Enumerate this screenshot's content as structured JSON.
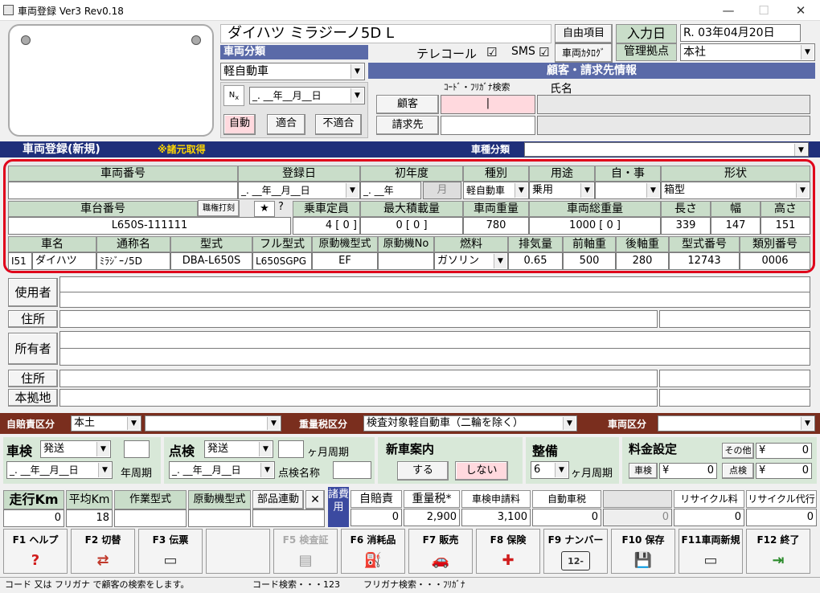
{
  "window": {
    "title": "車両登録 Ver3 Rev0.18",
    "min": "—",
    "max": "☐",
    "close": "✕"
  },
  "vehicle_title": "ダイハツ ミラジーノ5D L",
  "vehicle_class": {
    "label": "車両分類",
    "value": "軽自動車"
  },
  "telecall": {
    "label": "テレコール",
    "checked": "☑"
  },
  "sms": {
    "label": "SMS",
    "checked": "☑"
  },
  "buttons": {
    "free_item": "自由項目",
    "vehicle_catalog": "車両ｶﾀﾛｸﾞ",
    "auto": "自動",
    "fit": "適合",
    "unfit": "不適合",
    "customer": "顧客",
    "biller": "請求先",
    "inspect_yes": "する",
    "inspect_no": "しない",
    "shaken": "車検",
    "tenken": "点検",
    "other": "その他"
  },
  "input_date": {
    "label": "入力日",
    "value": "R. 03年04月20日"
  },
  "management": {
    "label": "管理拠点",
    "value": "本社"
  },
  "no_date": "_. __年__月__日",
  "customer_section": {
    "title": "顧客・請求先情報",
    "code_label": "ｺｰﾄﾞ・ﾌﾘｶﾞﾅ検索",
    "name_label": "氏名",
    "cursor": "|"
  },
  "reg_bar": {
    "title": "車両登録(新規)",
    "note": "※諸元取得",
    "type_label": "車種分類"
  },
  "row1": {
    "headers": [
      "車両番号",
      "登録日",
      "初年度",
      "種別",
      "用途",
      "自・事",
      "形状"
    ],
    "reg_date": "_. __年__月__日",
    "first_year": "_. __年",
    "first_month": "月",
    "kind": "軽自動車",
    "use": "乗用",
    "shape": "箱型"
  },
  "row2": {
    "headers": [
      "車台番号",
      "乗車定員",
      "最大積載量",
      "車両重量",
      "車両総重量",
      "長さ",
      "幅",
      "高さ"
    ],
    "stamp_btn": "職権打刻",
    "star": "★",
    "q": "?",
    "chassis": "L650S-111111",
    "capacity": "4 [ 0 ]",
    "max_load": "0 [ 0 ]",
    "weight": "780",
    "gross": "1000 [ 0 ]",
    "length": "339",
    "width": "147",
    "height": "151"
  },
  "row3": {
    "headers": [
      "車名",
      "通称名",
      "型式",
      "フル型式",
      "原動機型式",
      "原動機No",
      "燃料",
      "排気量",
      "前軸重",
      "後軸重",
      "型式番号",
      "類別番号"
    ],
    "maker_code": "I51",
    "maker": "ダイハツ",
    "common": "ﾐﾗｼﾞｰﾉ5D",
    "model": "DBA-L650S",
    "full_model": "L650SGPG",
    "engine": "EF",
    "fuel": "ガソリン",
    "displacement": "0.65",
    "front": "500",
    "rear": "280",
    "model_no": "12743",
    "class_no": "0006"
  },
  "owners": {
    "user": "使用者",
    "address1": "住所",
    "owner": "所有者",
    "address2": "住所",
    "base": "本拠地"
  },
  "tax_bar": {
    "jibai_label": "自賠責区分",
    "jibai_value": "本土",
    "weight_tax_label": "重量税区分",
    "weight_tax_value": "検査対象軽自動車（二輪を除く）",
    "vehicle_label": "車両区分"
  },
  "shaken": {
    "label": "車検",
    "value": "発送",
    "cycle": "年周期"
  },
  "tenken": {
    "label": "点検",
    "value": "発送",
    "cycle": "ヶ月周期",
    "name_label": "点検名称"
  },
  "new_car": {
    "label": "新車案内"
  },
  "seibi": {
    "label": "整備",
    "value": "6",
    "cycle": "ヶ月周期"
  },
  "fee": {
    "label": "料金設定",
    "yen": "¥",
    "v1": "0",
    "v2": "0",
    "v3": "0"
  },
  "mileage": {
    "label": "走行Km",
    "value": "0",
    "avg_label": "平均Km",
    "avg_value": "18",
    "work_model": "作業型式",
    "engine_model": "原動機型式",
    "parts": "部品連動",
    "x": "✕"
  },
  "costs": {
    "side": "諸費用",
    "headers": [
      "自賠責",
      "重量税",
      "車検申請料",
      "自動車税",
      "",
      "リサイクル料",
      "リサイクル代行"
    ],
    "values": [
      "0",
      "2,900",
      "3,100",
      "0",
      "0",
      "0",
      "0"
    ],
    "weight_mark": "*"
  },
  "fkeys": [
    {
      "key": "F1 ヘルプ",
      "icon": "?",
      "color": "#d01c1c"
    },
    {
      "key": "F2 切替",
      "icon": "⇄",
      "color": "#c0392b"
    },
    {
      "key": "F3 伝票",
      "icon": "▭",
      "color": "#333"
    },
    {
      "key": "",
      "icon": "",
      "color": "#333"
    },
    {
      "key": "F5 検査証",
      "icon": "▤",
      "color": "#999"
    },
    {
      "key": "F6 消耗品",
      "icon": "⛽",
      "color": "#333"
    },
    {
      "key": "F7 販売",
      "icon": "🚗",
      "color": "#2a8a2a"
    },
    {
      "key": "F8 保険",
      "icon": "✚",
      "color": "#d01c1c"
    },
    {
      "key": "F9 ナンバー",
      "icon": "12-34",
      "color": "#333"
    },
    {
      "key": "F10 保存",
      "icon": "💾",
      "color": "#333"
    },
    {
      "key": "F11車両新規",
      "icon": "▭",
      "color": "#333"
    },
    {
      "key": "F12 終了",
      "icon": "⇥",
      "color": "#2a8a2a"
    }
  ],
  "status": {
    "s1": "コード 又は フリガナ で顧客の検索をします。",
    "s2": "コード検索・・・123",
    "s3": "フリガナ検索・・・ﾌﾘｶﾞﾅ"
  },
  "colors": {
    "accent": "#1f2f7a",
    "brown": "#7a2e1e",
    "red": "#e0001b",
    "green": "#c9ddc9"
  }
}
